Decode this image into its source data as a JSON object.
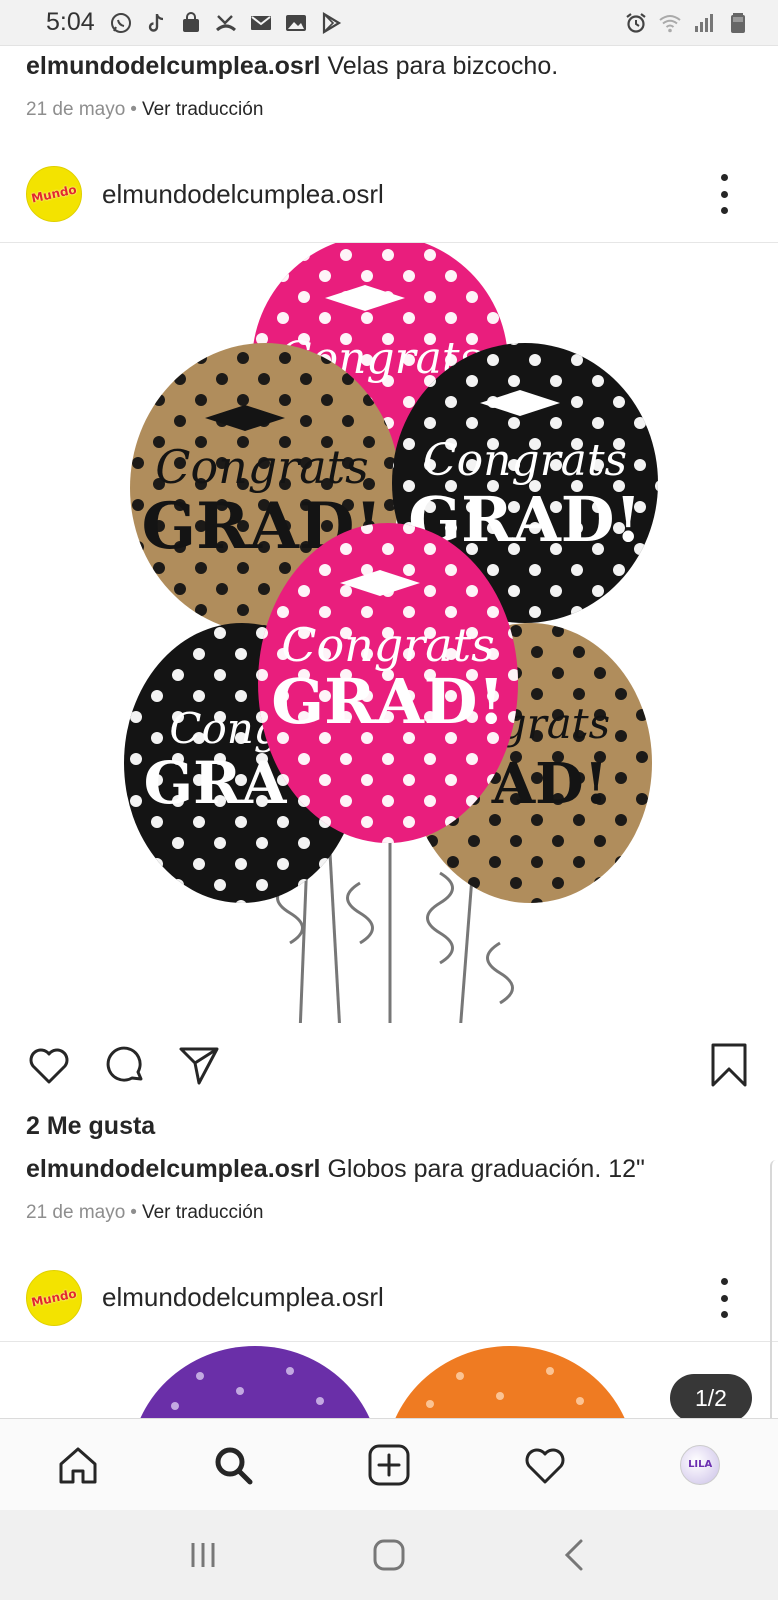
{
  "status_bar": {
    "time": "5:04",
    "left_icons": [
      "whatsapp-icon",
      "tiktok-icon",
      "shopping-bag-icon",
      "missed-call-icon",
      "gmail-icon",
      "gallery-icon",
      "play-store-icon"
    ],
    "right_icons": [
      "alarm-icon",
      "wifi-icon",
      "signal-icon",
      "battery-icon"
    ]
  },
  "previous_post": {
    "username": "elmundodelcumplea.osrl",
    "caption": "Velas para bizcocho.",
    "date": "21 de mayo",
    "translate": "Ver traducción"
  },
  "post": {
    "username": "elmundodelcumplea.osrl",
    "avatar_text": "Mundo",
    "image_description_colors": {
      "pink": "#e91e7d",
      "gold": "#b08d5c",
      "black": "#141414"
    },
    "balloon_text": {
      "line1": "Congrats",
      "line2": "GRAD!"
    },
    "likes": "2 Me gusta",
    "caption": "Globos para graduación. 12\"",
    "date": "21 de mayo",
    "translate": "Ver traducción"
  },
  "next_post": {
    "username": "elmundodelcumplea.osrl",
    "avatar_text": "Mundo",
    "page_indicator": "1/2"
  },
  "bottom_nav": {
    "items": [
      "home-icon",
      "search-icon",
      "add-post-icon",
      "activity-heart-icon",
      "profile-avatar"
    ],
    "profile_avatar_text": "LILA"
  },
  "system_nav": [
    "recent-apps-icon",
    "home-button-icon",
    "back-icon"
  ]
}
